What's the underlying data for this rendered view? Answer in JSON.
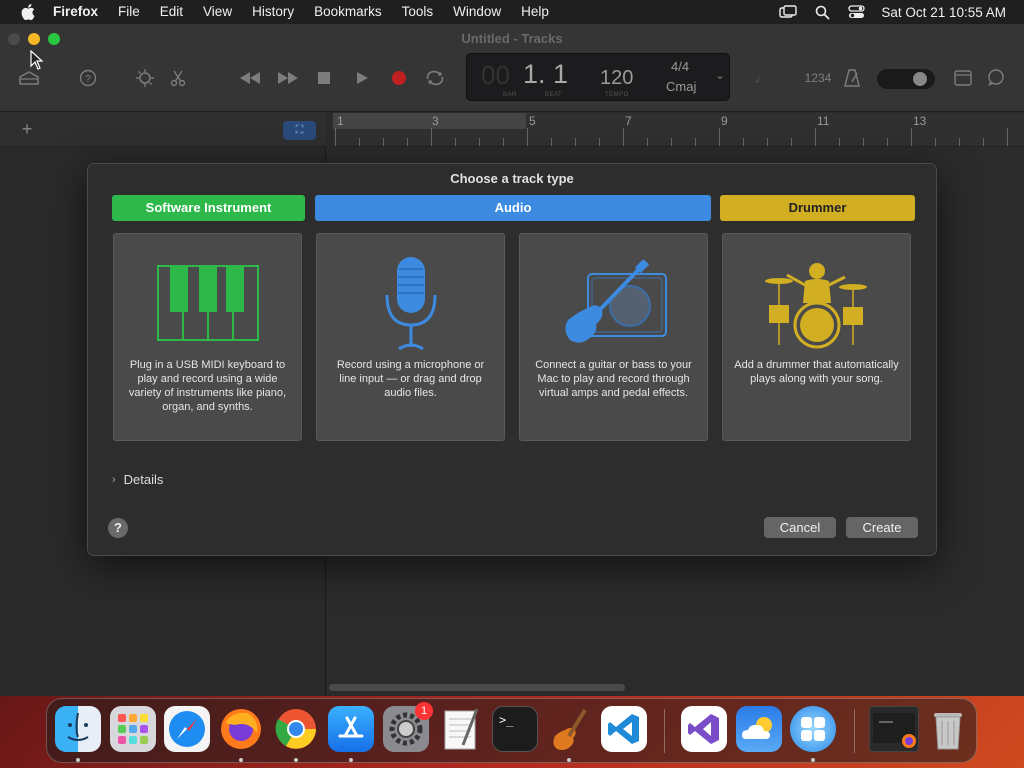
{
  "menubar": {
    "app_name": "Firefox",
    "items": [
      "File",
      "Edit",
      "View",
      "History",
      "Bookmarks",
      "Tools",
      "Window",
      "Help"
    ],
    "clock": "Sat Oct 21  10:55 AM"
  },
  "window": {
    "title": "Untitled - Tracks",
    "lcd": {
      "position": "1. 1",
      "position_labels": [
        "BAR",
        "BEAT"
      ],
      "tempo": "120",
      "tempo_label": "TEMPO",
      "time_signature": "4/4",
      "key": "Cmaj"
    },
    "meter_count_in": "1234",
    "ruler_marks": [
      "1",
      "3",
      "5",
      "7",
      "9",
      "11",
      "13"
    ]
  },
  "dialog": {
    "title": "Choose a track type",
    "categories": [
      {
        "label": "Software Instrument",
        "color": "#2eb84a"
      },
      {
        "label": "Audio",
        "color": "#3d8be0"
      },
      {
        "label": "Drummer",
        "color": "#d2ae22"
      }
    ],
    "cards": [
      {
        "icon": "keyboard-icon",
        "description": "Plug in a USB MIDI keyboard to play and record using a wide variety of instruments like piano, organ, and synths."
      },
      {
        "icon": "microphone-icon",
        "description": "Record using a microphone or line input — or drag and drop audio files."
      },
      {
        "icon": "guitar-icon",
        "description": "Connect a guitar or bass to your Mac to play and record through virtual amps and pedal effects."
      },
      {
        "icon": "drummer-icon",
        "description": "Add a drummer that automatically plays along with your song."
      }
    ],
    "details_label": "Details",
    "help_label": "?",
    "cancel_label": "Cancel",
    "create_label": "Create"
  },
  "dock": {
    "apps": [
      "finder-icon",
      "launchpad-icon",
      "safari-icon",
      "firefox-icon",
      "chrome-icon",
      "app-store-icon",
      "system-settings-icon",
      "textedit-icon",
      "terminal-icon",
      "garageband-icon",
      "vscode-icon",
      "visual-studio-icon",
      "weather-icon",
      "app-folder-icon",
      "firefox-window-icon",
      "trash-icon"
    ],
    "system_settings_badge": "1"
  }
}
